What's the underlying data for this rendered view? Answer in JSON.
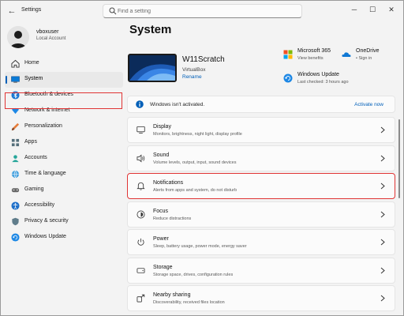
{
  "window": {
    "title": "Settings"
  },
  "search": {
    "placeholder": "Find a setting"
  },
  "user": {
    "name": "vboxuser",
    "account_type": "Local Account"
  },
  "sidebar": {
    "items": [
      {
        "label": "Home",
        "icon": "home-icon"
      },
      {
        "label": "System",
        "icon": "system-icon",
        "selected": true
      },
      {
        "label": "Bluetooth & devices",
        "icon": "bluetooth-icon"
      },
      {
        "label": "Network & internet",
        "icon": "wifi-icon"
      },
      {
        "label": "Personalization",
        "icon": "brush-icon"
      },
      {
        "label": "Apps",
        "icon": "apps-icon"
      },
      {
        "label": "Accounts",
        "icon": "person-icon"
      },
      {
        "label": "Time & language",
        "icon": "globe-icon"
      },
      {
        "label": "Gaming",
        "icon": "controller-icon"
      },
      {
        "label": "Accessibility",
        "icon": "accessibility-icon"
      },
      {
        "label": "Privacy & security",
        "icon": "shield-icon"
      },
      {
        "label": "Windows Update",
        "icon": "update-icon"
      }
    ]
  },
  "main": {
    "title": "System",
    "device": {
      "name": "W11Scratch",
      "model": "VirtualBox",
      "rename_label": "Rename"
    },
    "quick_links": [
      {
        "title": "Microsoft 365",
        "subtitle": "View benefits",
        "icon": "m365-icon"
      },
      {
        "title": "OneDrive",
        "subtitle": "• Sign in",
        "icon": "onedrive-icon"
      },
      {
        "title": "Windows Update",
        "subtitle": "Last checked: 3 hours ago",
        "icon": "update-icon"
      }
    ],
    "activation": {
      "text": "Windows isn't activated.",
      "link": "Activate now"
    },
    "settings": [
      {
        "title": "Display",
        "description": "Monitors, brightness, night light, display profile",
        "icon": "display-icon"
      },
      {
        "title": "Sound",
        "description": "Volume levels, output, input, sound devices",
        "icon": "speaker-icon"
      },
      {
        "title": "Notifications",
        "description": "Alerts from apps and system, do not disturb",
        "icon": "bell-icon",
        "highlighted": true
      },
      {
        "title": "Focus",
        "description": "Reduce distractions",
        "icon": "focus-icon"
      },
      {
        "title": "Power",
        "description": "Sleep, battery usage, power mode, energy saver",
        "icon": "power-icon"
      },
      {
        "title": "Storage",
        "description": "Storage space, drives, configuration rules",
        "icon": "storage-icon"
      },
      {
        "title": "Nearby sharing",
        "description": "Discoverability, received files location",
        "icon": "share-icon"
      }
    ]
  },
  "colors": {
    "accent": "#005fb8",
    "highlight": "#e03434",
    "background": "#f3f3f3",
    "card": "#fbfbfb"
  }
}
